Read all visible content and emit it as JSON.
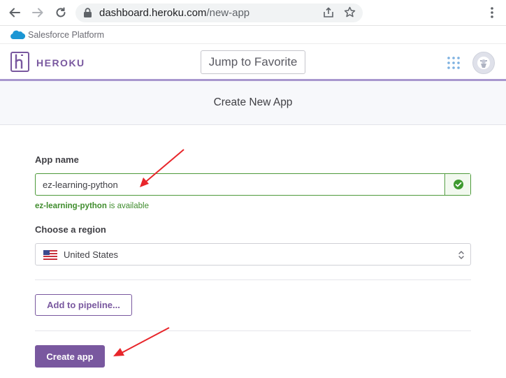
{
  "browser": {
    "url_domain": "dashboard.heroku.com",
    "url_path": "/new-app"
  },
  "salesforce": {
    "label": "Salesforce Platform"
  },
  "header": {
    "logo_text": "HEROKU",
    "jump_label": "Jump to Favorite"
  },
  "page": {
    "title": "Create New App"
  },
  "form": {
    "app_name_label": "App name",
    "app_name_value": "ez-learning-python",
    "availability_name": "ez-learning-python",
    "availability_suffix": " is available",
    "region_label": "Choose a region",
    "region_value": "United States",
    "pipeline_label": "Add to pipeline...",
    "create_label": "Create app"
  },
  "colors": {
    "brand": "#79589f",
    "success": "#408d2e",
    "annotation": "#e8262b"
  },
  "icons": [
    "back-arrow-icon",
    "forward-arrow-icon",
    "reload-icon",
    "lock-icon",
    "share-icon",
    "star-icon",
    "more-vert-icon",
    "salesforce-cloud-icon",
    "heroku-logo-icon",
    "apps-grid-icon",
    "avatar-icon",
    "check-circle-icon",
    "us-flag-icon",
    "select-arrows-icon"
  ]
}
